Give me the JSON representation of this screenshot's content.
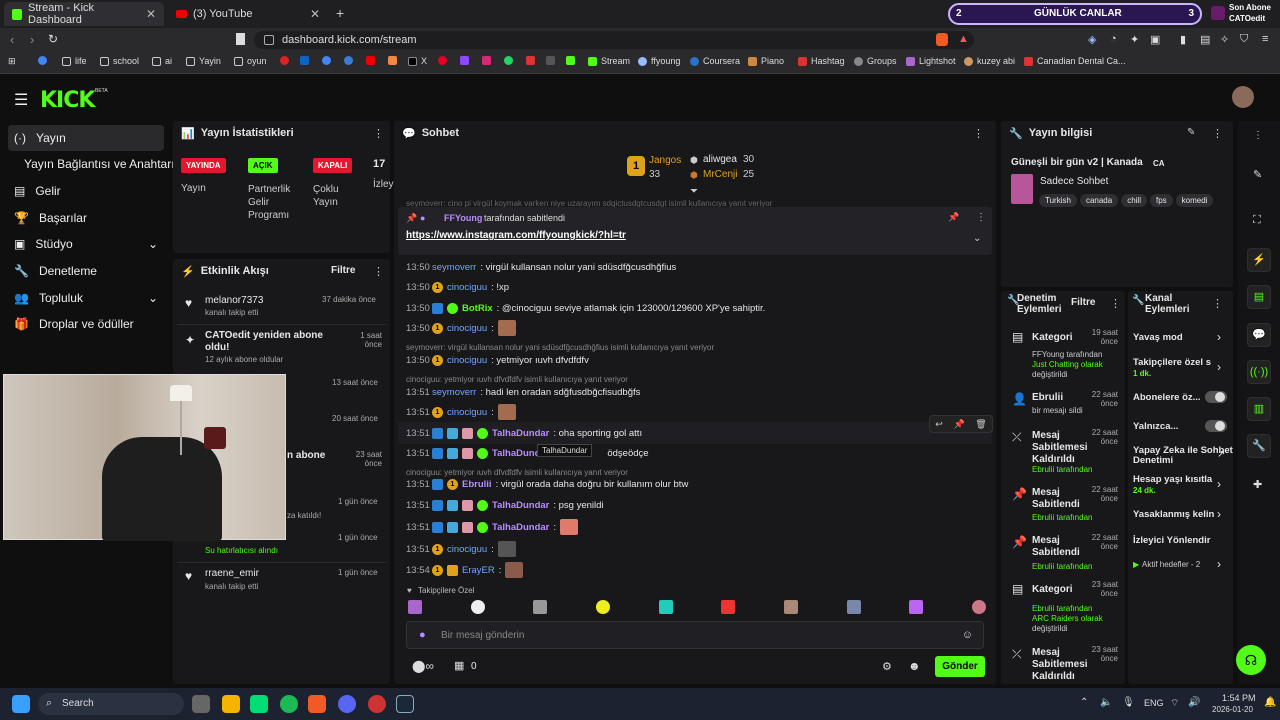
{
  "browser": {
    "tabs": [
      {
        "title": "Stream - Kick Dashboard"
      },
      {
        "title": "(3) YouTube"
      }
    ],
    "url": "dashboard.kick.com/stream",
    "bookmarks": [
      "life",
      "school",
      "ai",
      "Yayin",
      "oyun",
      "X",
      "Stream",
      "ffyoung",
      "Coursera",
      "Piano",
      "Hashtag",
      "Groups",
      "Lightshot",
      "kuzey abi",
      "Canadian Dental Ca..."
    ],
    "overlay": {
      "left_num": "2",
      "label": "GÜNLÜK CANLAR",
      "right_num": "3",
      "sub_title": "Son Abone",
      "sub_name": "CATOedit"
    }
  },
  "kick": {
    "logo": "KICK",
    "beta": "BETA",
    "nav": [
      "Yayın",
      "Yayın Bağlantısı ve Anahtarı",
      "Gelir",
      "Başarılar",
      "Stüdyo",
      "Denetleme",
      "Topluluk",
      "Droplar ve ödüller"
    ]
  },
  "stats": {
    "title": "Yayın İstatistikleri",
    "badges": [
      {
        "label": "YAYINDA",
        "caption": "Yayın",
        "color": "#e3172d"
      },
      {
        "label": "AÇIK",
        "caption": "Partnerlik Gelir Programı",
        "color": "#53fc18"
      },
      {
        "label": "KAPALI",
        "caption": "Çoklu Yayın",
        "color": "#e3172d"
      }
    ],
    "viewers": "17",
    "viewers_label": "İzley"
  },
  "activity": {
    "title": "Etkinlik Akışı",
    "filter": "Filtre",
    "items": [
      {
        "name": "melanor7373",
        "detail": "kanalı takip etti",
        "time": "37 dakika önce"
      },
      {
        "name": "CATOedit yeniden abone oldu!",
        "detail": "12 aylık abone oldular",
        "time": "1 saat önce"
      },
      {
        "name": "",
        "detail": "",
        "time": "13 saat önce"
      },
      {
        "name": "",
        "detail": "",
        "time": "20 saat önce"
      },
      {
        "name": "n abone",
        "detail": "",
        "time": "23 saat önce"
      },
      {
        "name": "",
        "detail": "za katıldı!",
        "time": "1 gün önce"
      },
      {
        "name": "",
        "detail": "Su hatırlatıcısı alındı",
        "time": "1 gün önce"
      },
      {
        "name": "rraene_emir",
        "detail": "kanalı takip etti",
        "time": "1 gün önce"
      }
    ]
  },
  "chat": {
    "title": "Sohbet",
    "leaders": [
      {
        "rank": "1",
        "name": "Jangos",
        "score": "33"
      },
      {
        "rank": "",
        "name": "aliwgea",
        "score": "30"
      },
      {
        "rank": "",
        "name": "MrCenji",
        "score": "25"
      }
    ],
    "faded_top": "seymoverr: cino pi virgül koymak varken niye uzarayım sdgictusdgtcusdgt isimli kullanıcıya yanıt veriyor",
    "pinned_by": "FFYoung",
    "pinned_suffix": "tarafından sabitlendi",
    "pinned_link": "https://www.instagram.com/ffyoungkick/?hl=tr",
    "messages": [
      {
        "time": "13:50",
        "user": "seymoverr",
        "text": ": virgül kullansan nolur yani sdüsdfğcusdhğfius"
      },
      {
        "time": "13:50",
        "user": "cinociguu",
        "text": ": !xp"
      },
      {
        "time": "13:50",
        "user": "BotRix",
        "text": ": @cinociguu seviye atlamak için 123000/129600 XP'ye sahiptir."
      },
      {
        "time": "13:50",
        "user": "cinociguu",
        "text": ":"
      },
      {
        "time": "13:50",
        "user": "cinociguu",
        "text": ": yetmiyor ıuvh dfvdfdfv"
      },
      {
        "time": "13:51",
        "user": "seymoverr",
        "text": ": hadi len oradan sdğfusdbğcfisudbğfs"
      },
      {
        "time": "13:51",
        "user": "cinociguu",
        "text": ":"
      },
      {
        "time": "13:51",
        "user": "TalhaDundar",
        "text": ": oha sporting gol attı"
      },
      {
        "time": "13:51",
        "user": "TalhaDundar",
        "text": "ödşeödçe"
      },
      {
        "time": "13:51",
        "user": "Ebrulii",
        "text": ": virgül orada daha doğru bir kullanım olur btw"
      },
      {
        "time": "13:51",
        "user": "TalhaDundar",
        "text": ": psg yenildi"
      },
      {
        "time": "13:51",
        "user": "TalhaDundar",
        "text": ":"
      },
      {
        "time": "13:51",
        "user": "cinociguu",
        "text": ":"
      },
      {
        "time": "13:54",
        "user": "ErayER",
        "text": ":"
      }
    ],
    "replies": [
      "seymoverr: virgül kullansan nolur yani sdüsdfğcusdhğfius isimli kullanıcıya yanıt veriyor",
      "cinociguu: yetmiyor ıuvh dfvdfdfv isimli kullanıcıya yanıt veriyor",
      "cinociguu: yetmiyor ıuvh dfvdfdfv isimli kullanıcıya yanıt veriyor"
    ],
    "tooltip": "TalhaDundar",
    "followers_only": "Takipçilere Özel",
    "placeholder": "Bir mesaj gönderin",
    "counter": "0",
    "send": "Gönder"
  },
  "info": {
    "title": "Yayın bilgisi",
    "stream_title": "Güneşli bir gün v2 | Kanada",
    "category": "Sadece Sohbet",
    "tags": [
      "Turkish",
      "canada",
      "chill",
      "fps",
      "komedi"
    ]
  },
  "mod": {
    "title": "Denetim Eylemleri",
    "filter": "Filtre",
    "items": [
      {
        "title": "Kategori",
        "time": "19 saat önce",
        "line1": "FFYoung tarafından",
        "line2": "Just Chatting olarak",
        "line3": "değiştirildi"
      },
      {
        "title": "Ebrulii",
        "time": "22 saat önce",
        "line1": "bir mesajı sildi",
        "line2": "",
        "line3": ""
      },
      {
        "title": "Mesaj Sabitlemesi Kaldırıldı",
        "time": "22 saat önce",
        "line1": "Ebrulii tarafından",
        "line2": "",
        "line3": ""
      },
      {
        "title": "Mesaj Sabitlendi",
        "time": "22 saat önce",
        "line1": "Ebrulii tarafından",
        "line2": "",
        "line3": ""
      },
      {
        "title": "Mesaj Sabitlendi",
        "time": "22 saat önce",
        "line1": "Ebrulii tarafından",
        "line2": "",
        "line3": ""
      },
      {
        "title": "Kategori",
        "time": "23 saat önce",
        "line1": "Ebrulii tarafından",
        "line2": "ARC Raiders olarak",
        "line3": "değiştirildi"
      },
      {
        "title": "Mesaj Sabitlemesi Kaldırıldı",
        "time": "23 saat önce",
        "line1": "",
        "line2": "",
        "line3": ""
      }
    ]
  },
  "channel": {
    "title": "Kanal Eylemleri",
    "items": [
      {
        "label": "Yavaş mod",
        "sub": ""
      },
      {
        "label": "Takipçilere özel s",
        "sub": "1 dk."
      },
      {
        "label": "Abonelere öz...",
        "sub": ""
      },
      {
        "label": "Yalnızca...",
        "sub": ""
      },
      {
        "label": "Yapay Zeka ile Sohbet Denetimi",
        "sub": ""
      },
      {
        "label": "Hesap yaşı kısıtla",
        "sub": "24 dk."
      },
      {
        "label": "Yasaklanmış kelin",
        "sub": ""
      },
      {
        "label": "İzleyici Yönlendir",
        "sub": ""
      },
      {
        "label": "Aktif hedefler - 2",
        "sub": ""
      }
    ]
  },
  "taskbar": {
    "search": "Search",
    "lang": "ENG",
    "time": "1:54 PM",
    "date": "2026-01-20"
  }
}
